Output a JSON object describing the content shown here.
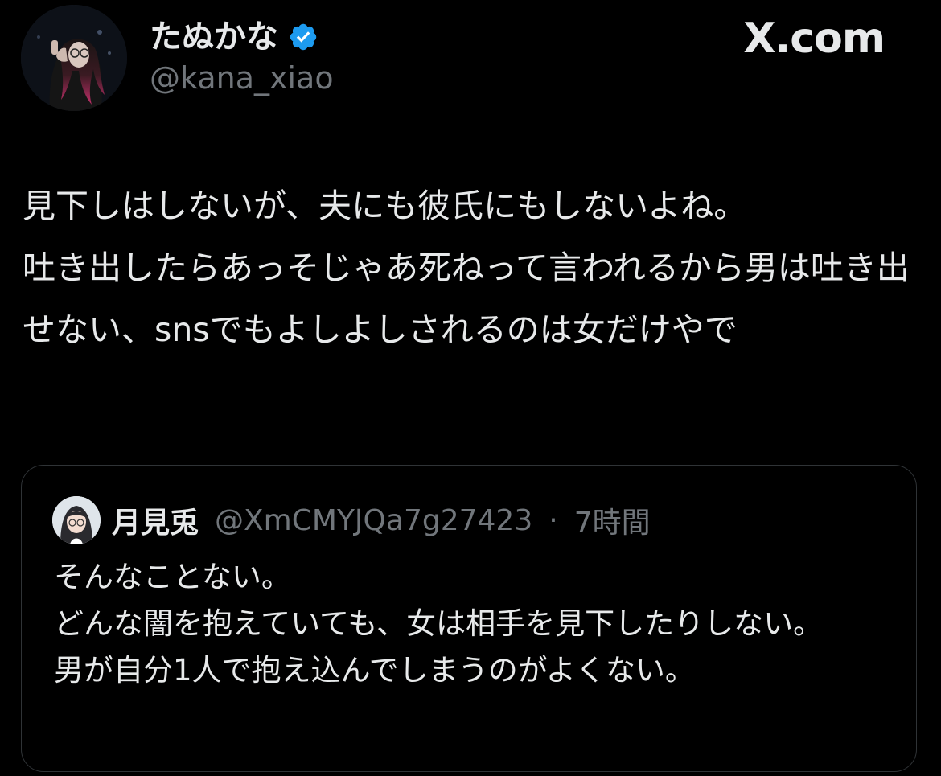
{
  "author": {
    "display_name": "たぬかな",
    "handle": "@kana_xiao",
    "verified": true,
    "verified_icon": "verified-badge-icon",
    "avatar_icon": "profile-avatar"
  },
  "site_watermark": "X.com",
  "tweet": {
    "text": "見下しはしないが、夫にも彼氏にもしないよね。\n吐き出したらあっそじゃあ死ねって言われるから男は吐き出せない、snsでもよしよしされるのは女だけやで"
  },
  "quote": {
    "display_name": "月見兎",
    "handle": "@XmCMYJQa7g27423",
    "separator": "·",
    "time": "7時間",
    "avatar_icon": "quoted-user-avatar",
    "text": "そんなことない。\nどんな闇を抱えていても、女は相手を見下したりしない。\n男が自分1人で抱え込んでしまうのがよくない。"
  },
  "colors": {
    "background": "#000000",
    "text_primary": "#e7e9ea",
    "text_secondary": "#71767b",
    "verified_blue": "#1d9bf0",
    "card_border": "#2f3336"
  }
}
